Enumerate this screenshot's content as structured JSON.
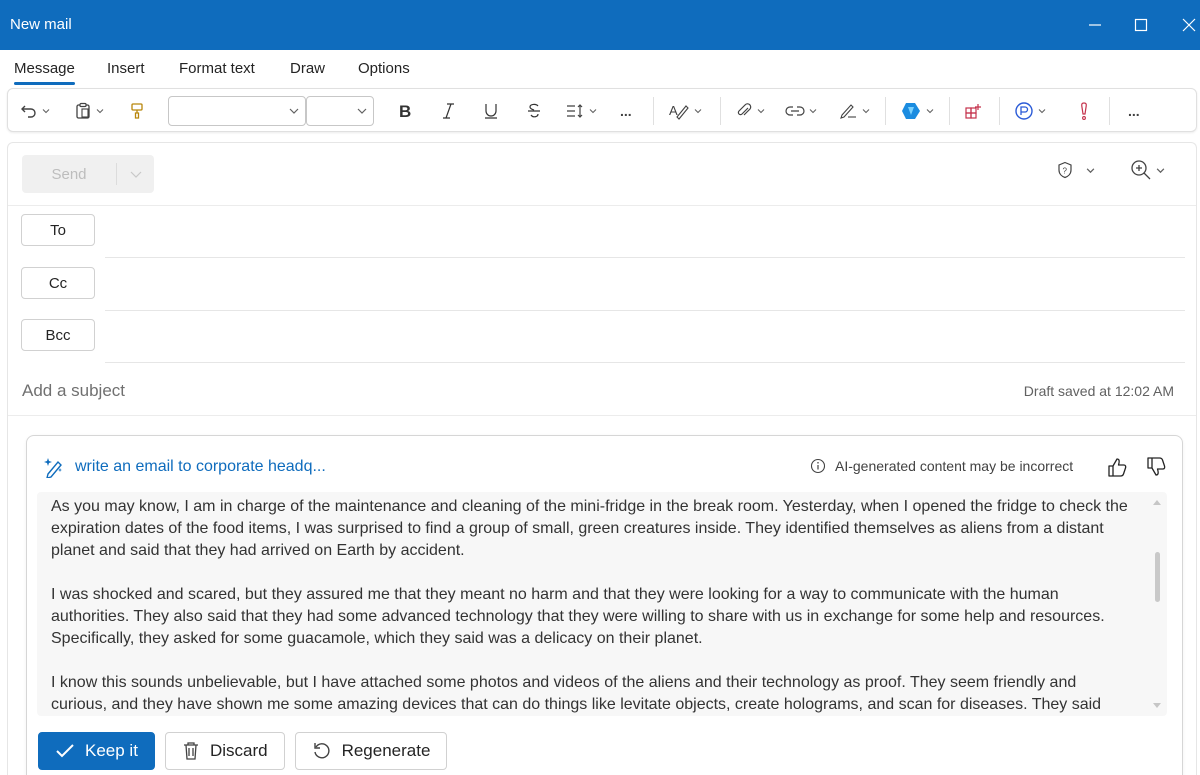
{
  "window": {
    "title": "New mail"
  },
  "ribbon": {
    "tabs": [
      {
        "label": "Message"
      },
      {
        "label": "Insert"
      },
      {
        "label": "Format text"
      },
      {
        "label": "Draw"
      },
      {
        "label": "Options"
      }
    ],
    "active_tab": "Message",
    "font_name": "",
    "font_size": ""
  },
  "toolbar": {
    "more_label": "..."
  },
  "compose": {
    "send_label": "Send",
    "to_label": "To",
    "cc_label": "Cc",
    "bcc_label": "Bcc",
    "subject_placeholder": "Add a subject",
    "draft_status": "Draft saved at 12:02 AM"
  },
  "copilot": {
    "prompt": "write an email to corporate headq...",
    "disclaimer": "AI-generated content may be incorrect",
    "paragraphs": [
      "As you may know, I am in charge of the maintenance and cleaning of the mini-fridge in the break room. Yesterday, when I opened the fridge to check the expiration dates of the food items, I was surprised to find a group of small, green creatures inside. They identified themselves as aliens from a distant planet and said that they had arrived on Earth by accident.",
      "I was shocked and scared, but they assured me that they meant no harm and that they were looking for a way to communicate with the human authorities. They also said that they had some advanced technology that they were willing to share with us in exchange for some help and resources. Specifically, they asked for some guacamole, which they said was a delicacy on their planet.",
      "I know this sounds unbelievable, but I have attached some photos and videos of the aliens and their technology as proof. They seem friendly and curious, and they have shown me some amazing devices that can do things like levitate objects, create holograms, and scan for diseases. They said"
    ],
    "keep_label": "Keep it",
    "discard_label": "Discard",
    "regenerate_label": "Regenerate"
  },
  "colors": {
    "brand": "#0f6cbd",
    "copilot_text": "#0f6cbd"
  }
}
